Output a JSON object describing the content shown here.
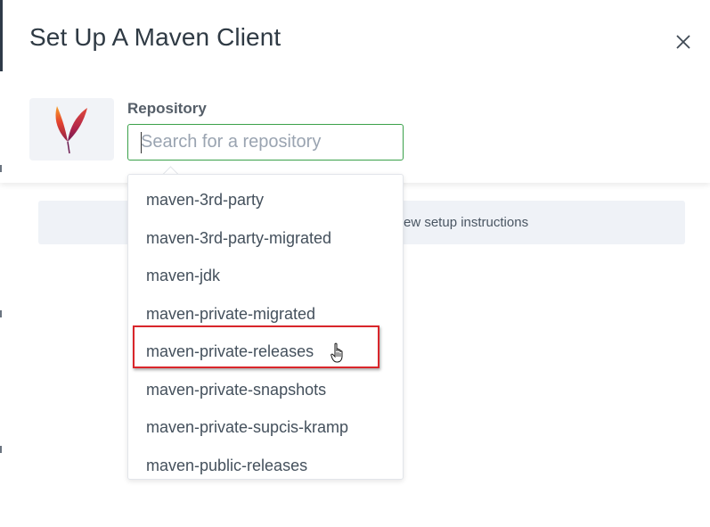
{
  "modal": {
    "title": "Set Up A Maven Client",
    "close_icon": "close-icon"
  },
  "repository": {
    "label": "Repository",
    "logo_icon": "apache-feather-icon",
    "search": {
      "placeholder": "Search for a repository",
      "value": ""
    }
  },
  "banner": {
    "text": "ew setup instructions"
  },
  "dropdown": {
    "items": [
      {
        "label": "maven-3rd-party"
      },
      {
        "label": "maven-3rd-party-migrated"
      },
      {
        "label": "maven-jdk"
      },
      {
        "label": "maven-private-migrated"
      },
      {
        "label": "maven-private-releases",
        "highlighted": true
      },
      {
        "label": "maven-private-snapshots"
      },
      {
        "label": "maven-private-supcis-kramp"
      },
      {
        "label": "maven-public-releases"
      }
    ]
  },
  "colors": {
    "input_border": "#3aa14a",
    "highlight_border": "#d9262b",
    "banner_bg": "#eff2f7"
  },
  "pointer_icon": "hand-pointer-icon"
}
